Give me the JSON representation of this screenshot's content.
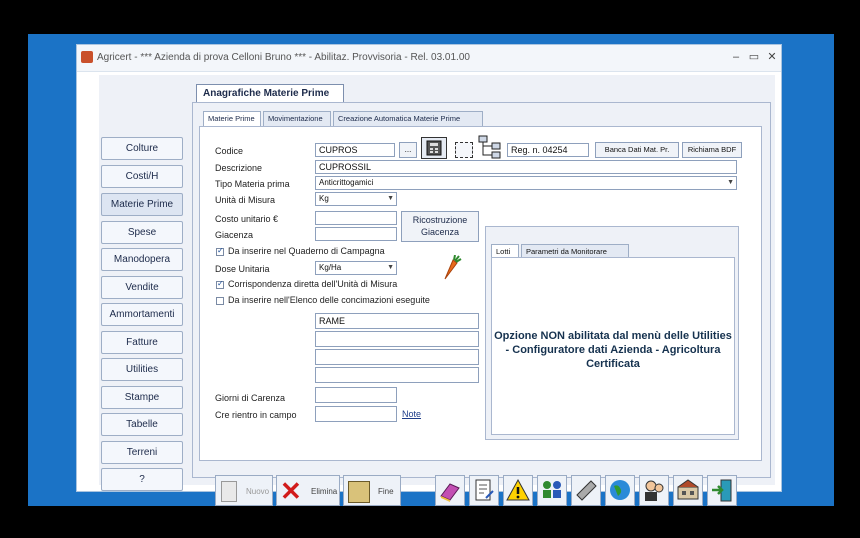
{
  "window": {
    "title": "Agricert - *** Azienda di prova Celloni Bruno *** - Abilitaz. Provvisoria - Rel. 03.01.00",
    "minimize": "–",
    "maximize": "▭",
    "close": "✕"
  },
  "sidebar": {
    "items": [
      {
        "label": "Colture"
      },
      {
        "label": "Costi/H"
      },
      {
        "label": "Materie Prime"
      },
      {
        "label": "Spese"
      },
      {
        "label": "Manodopera"
      },
      {
        "label": "Vendite"
      },
      {
        "label": "Ammortamenti"
      },
      {
        "label": "Fatture"
      },
      {
        "label": "Utilities"
      },
      {
        "label": "Stampe"
      },
      {
        "label": "Tabelle"
      },
      {
        "label": "Terreni"
      },
      {
        "label": "?"
      }
    ]
  },
  "section": {
    "title": "Anagrafiche Materie Prime"
  },
  "tabs": [
    {
      "label": "Materie Prime"
    },
    {
      "label": "Movimentazione"
    },
    {
      "label": "Creazione Automatica Materie Prime"
    }
  ],
  "form": {
    "codice_label": "Codice",
    "codice_value": "CUPROS",
    "browse_label": "...",
    "reg_label": "Reg. n. 04254",
    "banca_dati_label": "Banca Dati Mat. Pr.",
    "richiama_label": "Richiama BDF",
    "descrizione_label": "Descrizione",
    "descrizione_value": "CUPROSSIL",
    "tipo_label": "Tipo Materia prima",
    "tipo_value": "Anticrittogamici",
    "unita_label": "Unità di Misura",
    "unita_value": "Kg",
    "costo_label": "Costo unitario €",
    "costo_value": "",
    "giacenza_label": "Giacenza",
    "giacenza_value": "",
    "ricostruzione_label": "Ricostruzione Giacenza",
    "quaderno_label": "Da inserire nel Quaderno di Campagna",
    "dose_label": "Dose Unitaria",
    "dose_value": "Kg/Ha",
    "corrispondenza_label": "Corrispondenza diretta dell'Unità di Misura",
    "elenco_label": "Da inserire nell'Elenco delle concimazioni eseguite",
    "principi": [
      "RAME",
      "",
      "",
      "",
      ""
    ],
    "giorni_label": "Giorni di Carenza",
    "giorni_value": "",
    "rientro_label": "Cre rientro in campo",
    "rientro_value": "",
    "note_label": "Note"
  },
  "subtabs": [
    {
      "label": "Lotti"
    },
    {
      "label": "Parametri da Monitorare"
    }
  ],
  "message": "Opzione NON abilitata dal menù delle Utilities - Configuratore dati Azienda - Agricoltura Certificata",
  "bottom": {
    "nuovo_label": "Nuovo",
    "elimina_label": "Elimina",
    "fine_label": "Fine"
  }
}
